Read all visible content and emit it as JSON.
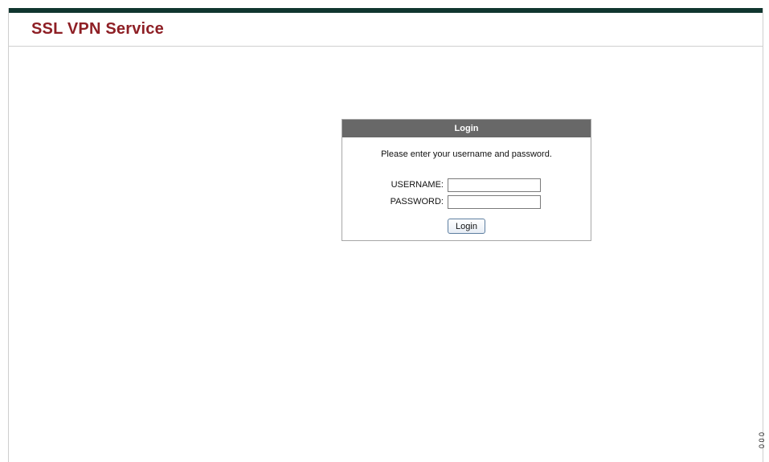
{
  "header": {
    "title": "SSL VPN Service"
  },
  "login": {
    "title": "Login",
    "instructions": "Please enter your username and password.",
    "username_label": "USERNAME:",
    "username_value": "",
    "password_label": "PASSWORD:",
    "password_value": "",
    "submit_label": "Login"
  },
  "side_code": {
    "text": "0 0 0"
  },
  "colors": {
    "top_bar": "#10362f",
    "title": "#8e1f25",
    "panel_header": "#686868",
    "border": "#a7a7a7"
  }
}
